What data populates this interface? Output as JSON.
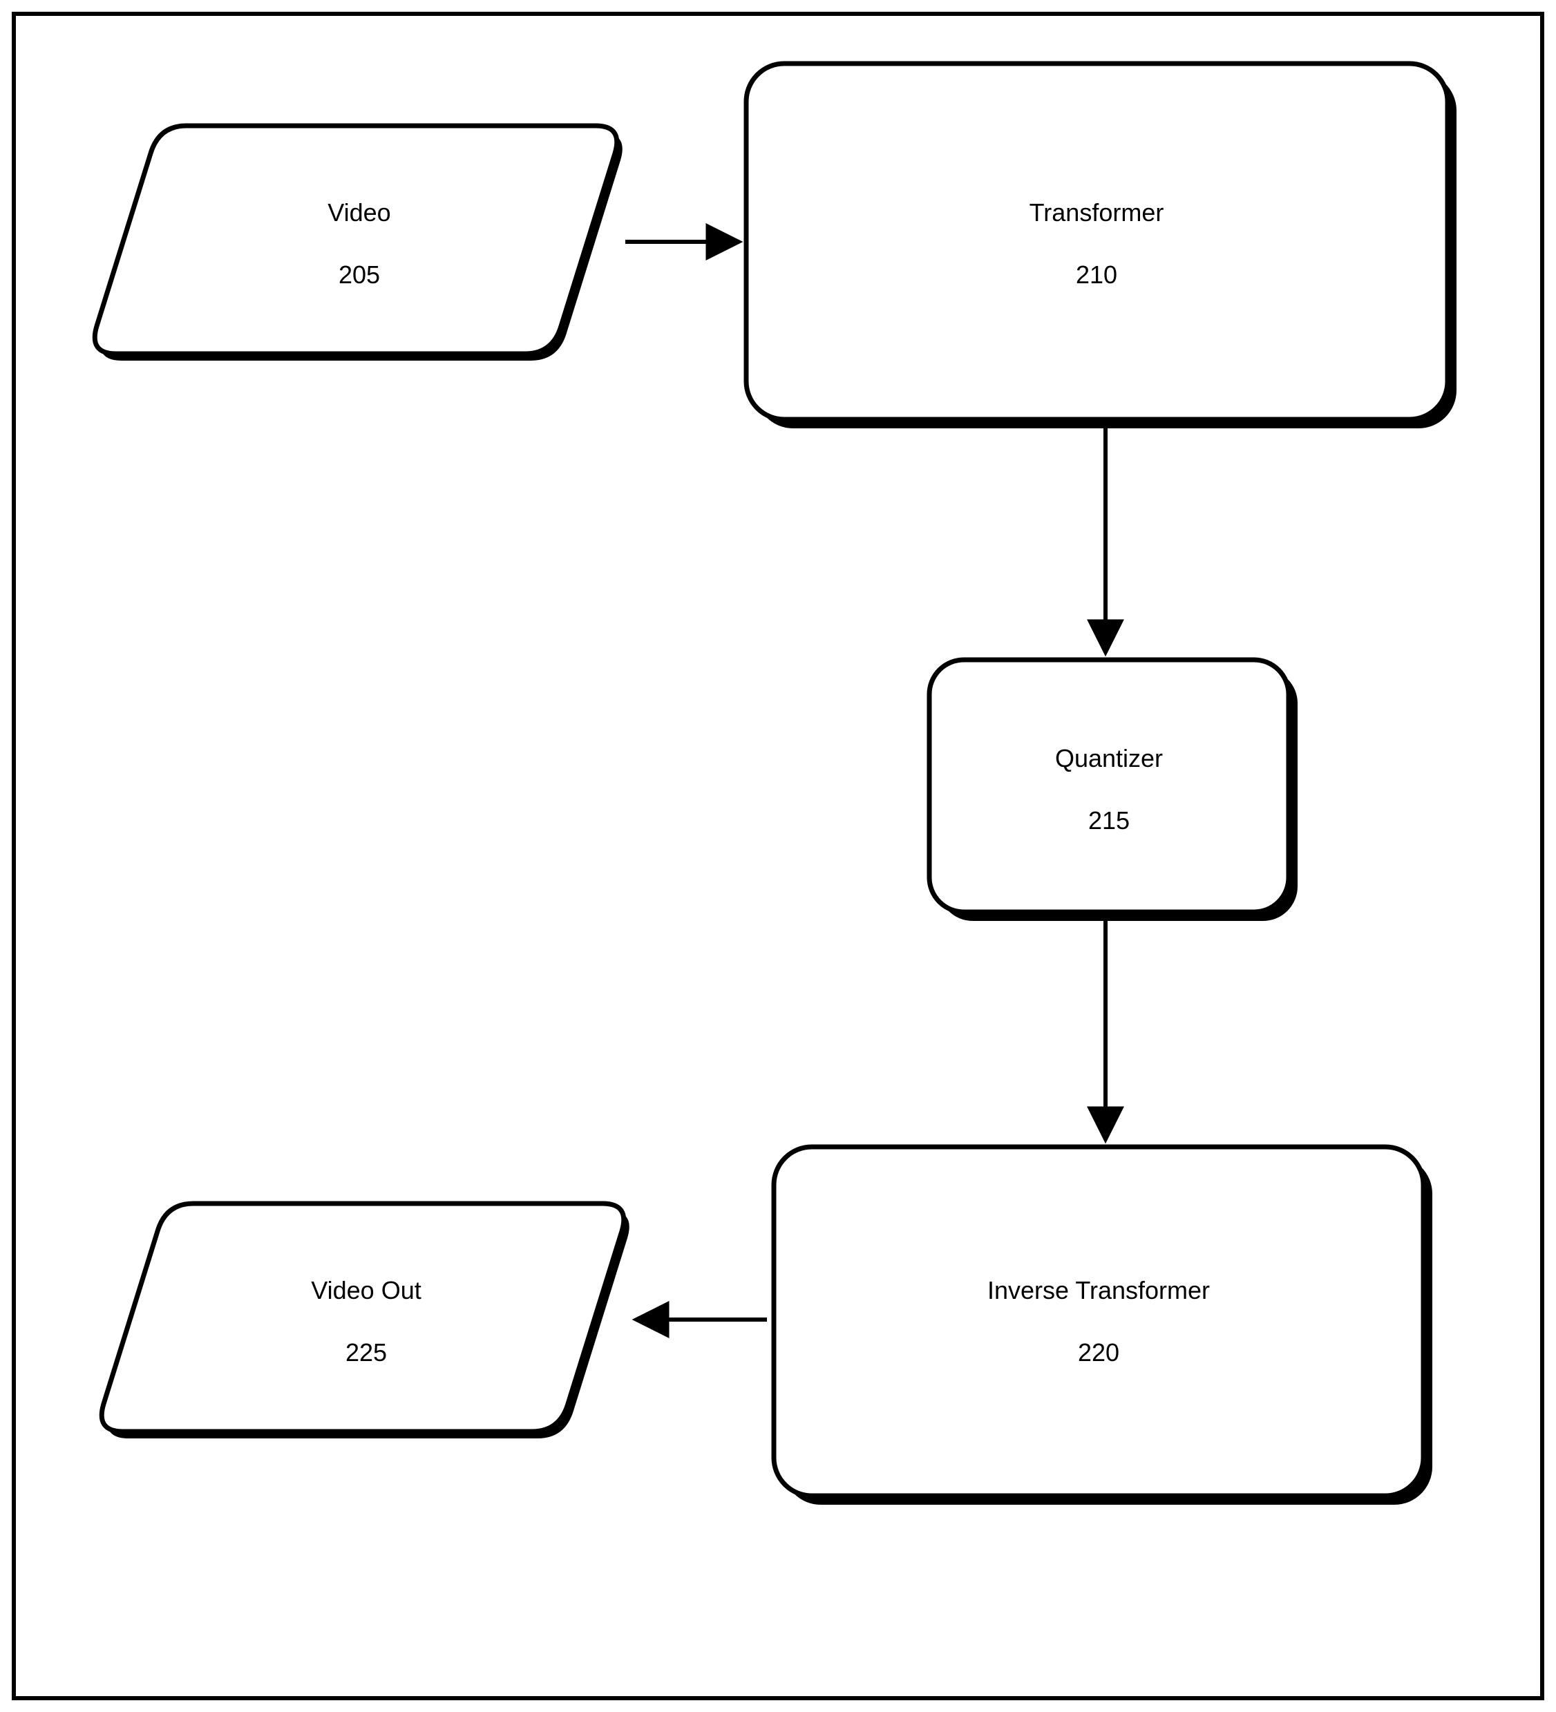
{
  "nodes": {
    "video": {
      "label": "Video",
      "num": "205"
    },
    "transformer": {
      "label": "Transformer",
      "num": "210"
    },
    "quantizer": {
      "label": "Quantizer",
      "num": "215"
    },
    "inverse": {
      "label": "Inverse Transformer",
      "num": "220"
    },
    "videoOut": {
      "label": "Video Out",
      "num": "225"
    }
  }
}
